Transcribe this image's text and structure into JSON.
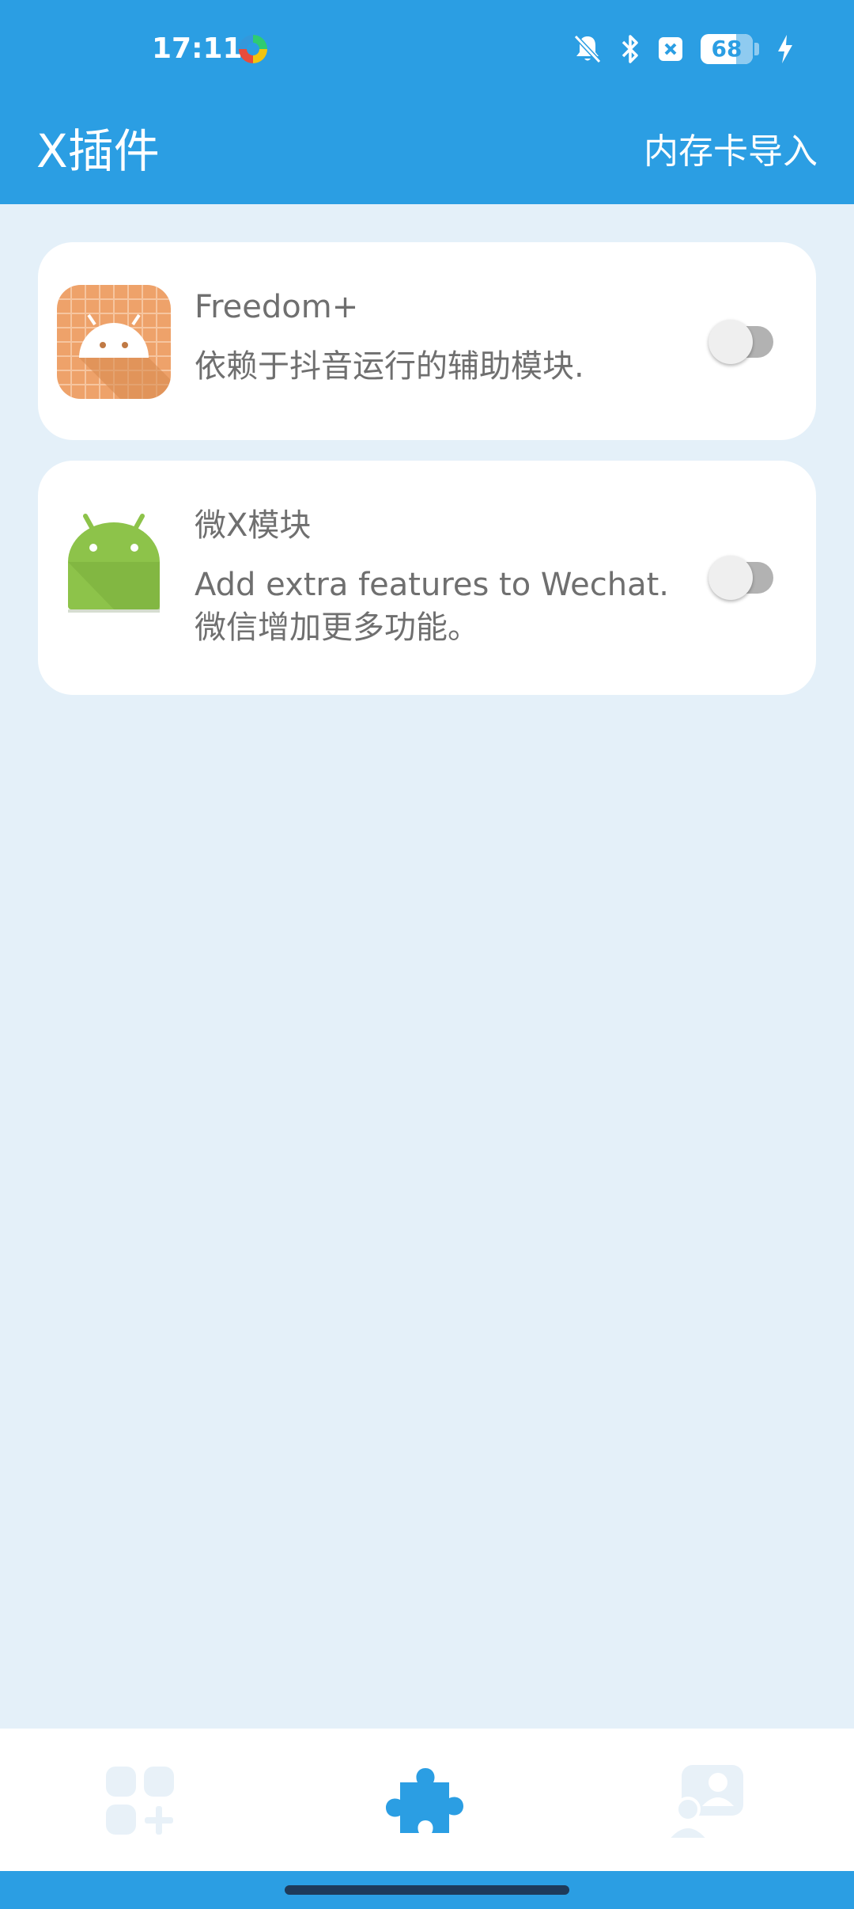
{
  "status_bar": {
    "time": "17:11",
    "app_icon": "colorful-circle-app-icon",
    "icons": [
      "notifications-off-icon",
      "bluetooth-icon",
      "close-box-icon",
      "battery-icon",
      "charging-bolt-icon"
    ],
    "battery_level": "68",
    "battery_fraction": 0.68
  },
  "app_bar": {
    "title": "X插件",
    "action_label": "内存卡导入"
  },
  "modules": [
    {
      "name": "Freedom+",
      "description_lines": [
        "依赖于抖音运行的辅助模块."
      ],
      "icon": "freedom-android-icon",
      "enabled": false
    },
    {
      "name": "微X模块",
      "description_lines": [
        "Add extra features to Wechat.",
        "微信增加更多功能。"
      ],
      "icon": "android-robot-icon",
      "enabled": false
    }
  ],
  "bottom_nav": {
    "items": [
      {
        "icon": "apps-add-icon",
        "selected": false
      },
      {
        "icon": "puzzle-piece-icon",
        "selected": true
      },
      {
        "icon": "user-profile-icon",
        "selected": false
      }
    ]
  },
  "colors": {
    "primary": "#2B9EE3",
    "background": "#E4F0F9",
    "card": "#FFFFFF",
    "text_secondary": "#6F6F6F",
    "nav_inactive": "#E8F1F8",
    "nav_active": "#2B9EE3"
  }
}
